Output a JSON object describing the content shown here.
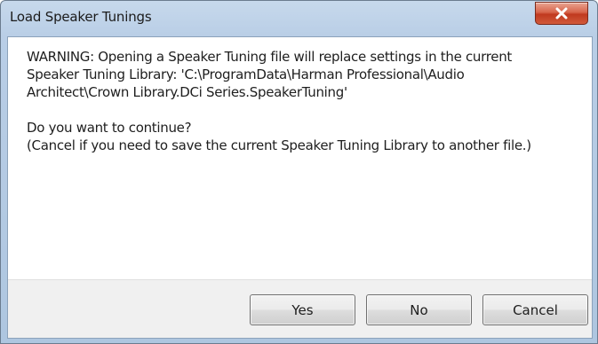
{
  "dialog": {
    "title": "Load Speaker Tunings",
    "close_icon": "close-x-icon",
    "warning_text": "WARNING: Opening a Speaker Tuning file will replace settings in the current Speaker Tuning Library: 'C:\\ProgramData\\Harman Professional\\Audio Architect\\Crown Library.DCi Series.SpeakerTuning'",
    "question_line1": "Do you want to continue?",
    "question_line2": "(Cancel if you need to save the current Speaker Tuning Library to another file.)"
  },
  "buttons": {
    "yes": "Yes",
    "no": "No",
    "cancel": "Cancel"
  },
  "colors": {
    "close_button": "#c7442a",
    "title_bar": "#b9cee6",
    "button_bar": "#f0f0f0"
  }
}
